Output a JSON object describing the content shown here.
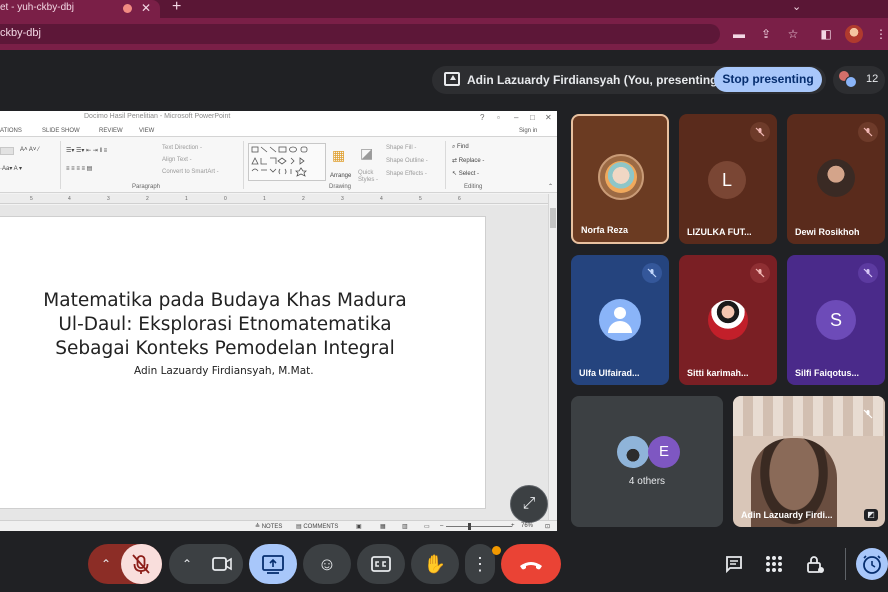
{
  "browser": {
    "tab_title": "et - yuh-ckby-dbj",
    "url_fragment": "ckby-dbj"
  },
  "meet": {
    "presenting_label": "Adin Lazuardy Firdiansyah (You, presenting)",
    "stop_presenting": "Stop presenting",
    "people_count": "12"
  },
  "ppt": {
    "window_title": "Docimo Hasil Penelitian - Microsoft PowerPoint",
    "menu": [
      "ATIONS",
      "SLIDE SHOW",
      "REVIEW",
      "VIEW"
    ],
    "sign_in": "Sign in",
    "ribbon": {
      "text_direction": "Text Direction -",
      "align_text": "Align Text -",
      "convert_smartart": "Convert to SmartArt -",
      "paragraph": "Paragraph",
      "drawing": "Drawing",
      "arrange": "Arrange",
      "quick_styles": "Quick Styles -",
      "shape_fill": "Shape Fill -",
      "shape_outline": "Shape Outline -",
      "shape_effects": "Shape Effects -",
      "find": "Find",
      "replace": "Replace -",
      "select": "Select -",
      "editing": "Editing"
    },
    "slide": {
      "title_line1": "Matematika pada Budaya Khas Madura",
      "title_line2": "Ul-Daul: Eksplorasi Etnomatematika",
      "title_line3": "Sebagai Konteks Pemodelan Integral",
      "author": "Adin Lazuardy Firdiansyah, M.Mat."
    },
    "status": {
      "notes": "NOTES",
      "comments": "COMMENTS",
      "zoom": "76%"
    }
  },
  "participants": [
    {
      "name": "Norfa Reza",
      "bg": "#6b3b22"
    },
    {
      "name": "LIZULKA FUT...",
      "initial": "L",
      "bg": "#5a2b1c"
    },
    {
      "name": "Dewi Rosikhoh",
      "bg": "#5a2b1c"
    },
    {
      "name": "Ulfa Ulfairad...",
      "bg": "#25447e"
    },
    {
      "name": "Sitti karimah...",
      "bg": "#7a1f24"
    },
    {
      "name": "Silfi Faiqotus...",
      "initial": "S",
      "bg": "#4a2a8a"
    },
    {
      "name": "Adin Lazuardy Firdi...",
      "bg": "#cdb7a8"
    }
  ],
  "others": {
    "label": "4 others",
    "initial": "E"
  },
  "colors": {
    "accent_blue": "#a8c7fa",
    "end_call_red": "#ea4335",
    "mic_off_red": "#f9dedc",
    "selected_tile_border": "#e8c1a0"
  }
}
